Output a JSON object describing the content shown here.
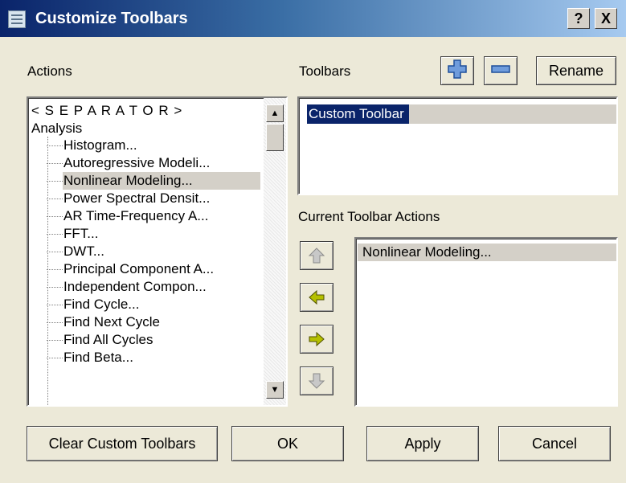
{
  "window": {
    "title": "Customize Toolbars",
    "help_label": "?",
    "close_label": "X"
  },
  "actions": {
    "label": "Actions",
    "items": [
      "< S E P A R A T O R >",
      "Analysis",
      "Histogram...",
      "Autoregressive Modeli...",
      "Nonlinear Modeling...",
      "Power Spectral Densit...",
      "AR Time-Frequency A...",
      "FFT...",
      "DWT...",
      "Principal Component A...",
      "Independent Compon...",
      "Find Cycle...",
      "Find Next Cycle",
      "Find All Cycles",
      "Find Beta..."
    ]
  },
  "toolbars": {
    "label": "Toolbars",
    "add_icon": "plus-icon",
    "remove_icon": "minus-icon",
    "rename_label": "Rename",
    "items": [
      "Custom Toolbar"
    ]
  },
  "current": {
    "label": "Current Toolbar Actions",
    "items": [
      "Nonlinear Modeling..."
    ]
  },
  "footer": {
    "clear_label": "Clear Custom Toolbars",
    "ok_label": "OK",
    "apply_label": "Apply",
    "cancel_label": "Cancel"
  },
  "colors": {
    "selection": "#0a246a",
    "arrow_active": "#a8b400",
    "arrow_disabled": "#b8b8b8"
  }
}
